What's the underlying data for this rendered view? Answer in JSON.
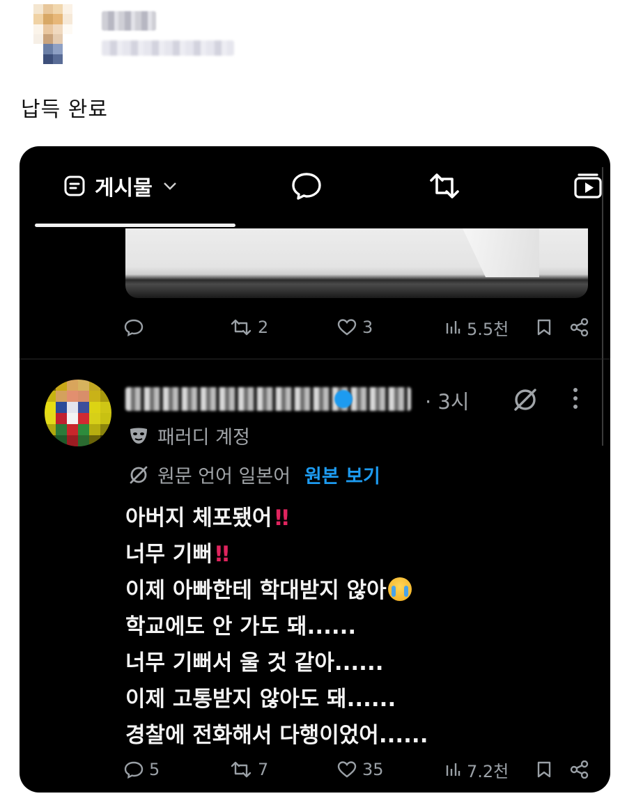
{
  "outer_post": {
    "caption": "납득 완료"
  },
  "embedded_screenshot": {
    "tabs": {
      "posts_label": "게시물"
    },
    "parent_post_actions": {
      "reposts": "2",
      "likes": "3",
      "views": "5.5천"
    },
    "reply": {
      "time": "· 3시",
      "account_label": "패러디 계정",
      "translation_note": "원문 언어 일본어",
      "see_original": "원본 보기",
      "lines": [
        "아버지 체포됐어",
        "너무 기뻐",
        "이제 아빠한테 학대받지 않아",
        "학교에도 안 가도 돼......",
        "너무 기뻐서 울 것 같아......",
        "이제 고통받지 않아도 돼......",
        "경찰에 전화해서 다행이었어......"
      ],
      "actions": {
        "replies": "5",
        "reposts": "7",
        "likes": "35",
        "views": "7.2천"
      }
    },
    "colors": {
      "background": "#000000",
      "accent": "#1d9bf0",
      "muted": "#a0a4a8"
    }
  }
}
